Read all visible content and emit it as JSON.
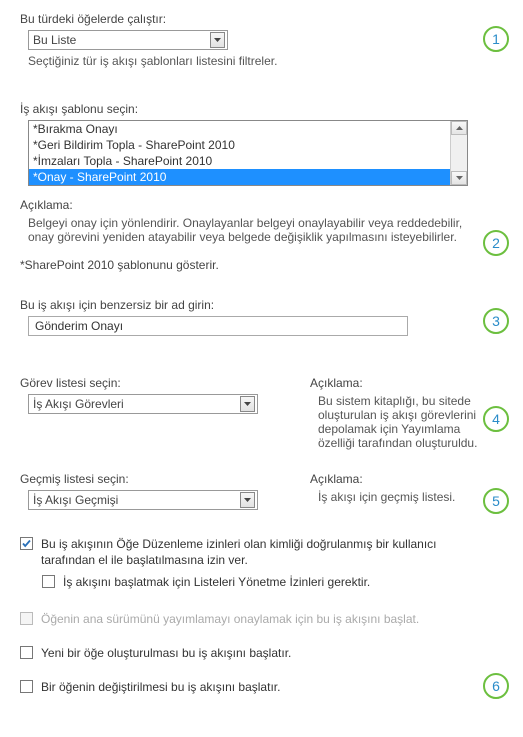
{
  "run_on": {
    "label": "Bu türdeki öğelerde çalıştır:",
    "value": "Bu Liste",
    "help": "Seçtiğiniz tür iş akışı şablonları listesini filtreler."
  },
  "template": {
    "label": "İş akışı şablonu seçin:",
    "items": [
      "*Bırakma Onayı",
      "*Geri Bildirim Topla - SharePoint 2010",
      "*İmzaları Topla - SharePoint 2010",
      "*Onay - SharePoint 2010"
    ],
    "selected_index": 3,
    "desc_label": "Açıklama:",
    "desc_text": "Belgeyi onay için yönlendirir. Onaylayanlar belgeyi onaylayabilir veya reddedebilir, onay görevini yeniden atayabilir veya belgede değişiklik yapılmasını isteyebilirler.",
    "note": "*SharePoint 2010 şablonunu gösterir."
  },
  "name": {
    "label": "Bu iş akışı için benzersiz bir ad girin:",
    "value": "Gönderim Onayı"
  },
  "task_list": {
    "label": "Görev listesi seçin:",
    "value": "İş Akışı Görevleri",
    "desc_label": "Açıklama:",
    "desc_text": "Bu sistem kitaplığı, bu sitede oluşturulan iş akışı görevlerini depolamak için Yayımlama özelliği tarafından oluşturuldu."
  },
  "history_list": {
    "label": "Geçmiş listesi seçin:",
    "value": "İş Akışı Geçmişi",
    "desc_label": "Açıklama:",
    "desc_text": "İş akışı için geçmiş listesi."
  },
  "options": {
    "manual": {
      "label": "Bu iş akışının Öğe Düzenleme izinleri olan kimliği doğrulanmış bir kullanıcı tarafından el ile başlatılmasına izin ver.",
      "checked": true
    },
    "require_manage": {
      "label": "İş akışını başlatmak için Listeleri Yönetme İzinleri gerektir.",
      "checked": false
    },
    "on_publish": {
      "label": "Öğenin ana sürümünü yayımlamayı onaylamak için bu iş akışını başlat.",
      "checked": false,
      "disabled": true
    },
    "on_create": {
      "label": "Yeni bir öğe oluşturulması bu iş akışını başlatır.",
      "checked": false
    },
    "on_change": {
      "label": "Bir öğenin değiştirilmesi bu iş akışını başlatır.",
      "checked": false
    }
  },
  "badges": {
    "b1": "1",
    "b2": "2",
    "b3": "3",
    "b4": "4",
    "b5": "5",
    "b6": "6"
  }
}
